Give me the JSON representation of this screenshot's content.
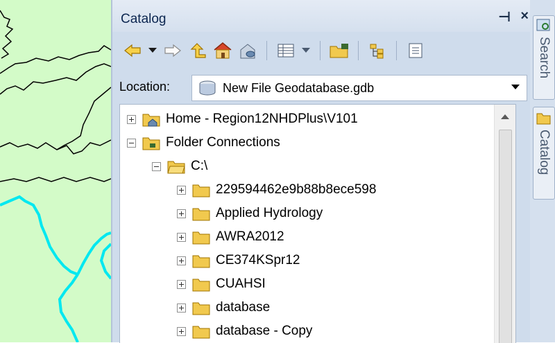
{
  "catalog": {
    "title": "Catalog",
    "pin_symbol": "⊣",
    "close_symbol": "×"
  },
  "toolbar": {
    "buttons": [
      "back-arrow-icon",
      "dropdown-arrow-icon",
      "forward-arrow-icon",
      "up-one-level-icon",
      "home-icon",
      "toggle-contents-icon",
      "views-icon",
      "connect-folder-icon",
      "tree-view-icon",
      "options-icon"
    ]
  },
  "location": {
    "label": "Location:",
    "value": "New File Geodatabase.gdb"
  },
  "tree": {
    "home": "Home - Region12NHDPlus\\V101",
    "folder_connections": "Folder Connections",
    "drive": "C:\\",
    "folders": [
      "229594462e9b88b8ece598",
      "Applied Hydrology",
      "AWRA2012",
      "CE374KSpr12",
      "CUAHSI",
      "database",
      "database - Copy"
    ]
  },
  "dock": {
    "search_tab": "Search",
    "catalog_tab": "Catalog"
  },
  "colors": {
    "map_background": "#d3fbc8",
    "river": "#00e8f0",
    "catalog_background": "#cfdcec"
  }
}
